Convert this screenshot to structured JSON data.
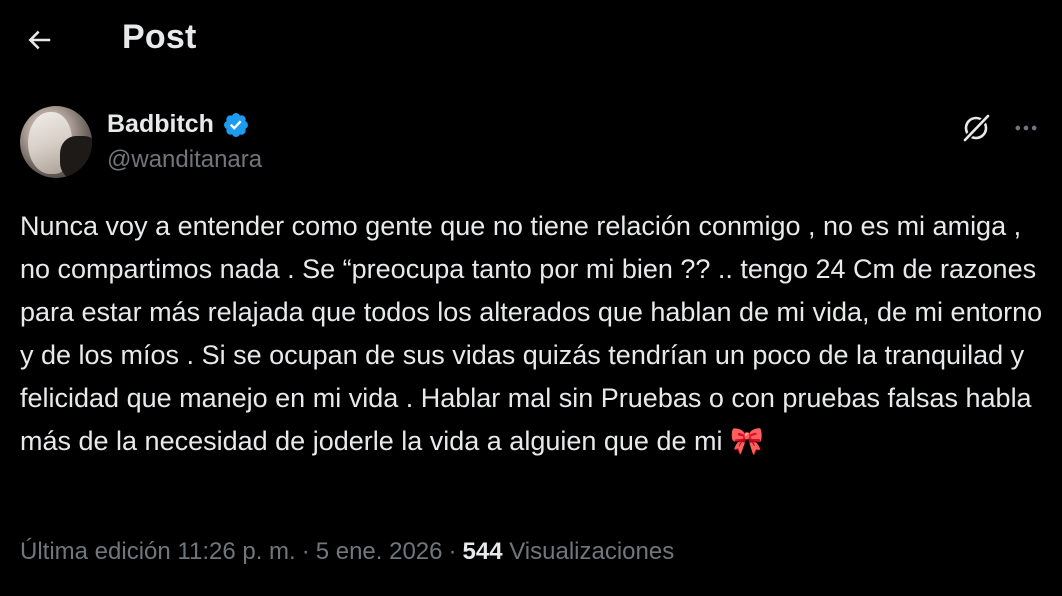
{
  "header": {
    "title": "Post",
    "back_icon": "arrow-left-icon"
  },
  "author": {
    "display_name": "Badbitch",
    "handle": "@wanditanara",
    "verified": true,
    "verified_color": "#1d9bf0"
  },
  "actions": {
    "grok_icon": "grok-icon",
    "more_icon": "more-horizontal-icon"
  },
  "post": {
    "text": "Nunca voy a entender como gente que no tiene relación conmigo , no es mi amiga , no compartimos nada . Se “preocupa tanto por mi bien ?? .. tengo 24 Cm de razones para estar más relajada que todos los alterados que hablan de mi vida, de mi entorno y de los míos . Si se ocupan de sus vidas quizás tendrían un poco de la tranquilad y felicidad que manejo en mi vida . Hablar mal sin Pruebas o con pruebas falsas habla más de la necesidad de joderle la vida a alguien que de mi 🎀"
  },
  "meta": {
    "edited_label": "Última edición",
    "time": "11:26 p. m.",
    "separator": "·",
    "date": "5 ene. 2026",
    "views_count": "544",
    "views_label": "Visualizaciones"
  },
  "colors": {
    "background": "#000000",
    "text_primary": "#e7e9ea",
    "text_secondary": "#71767b",
    "accent": "#1d9bf0"
  }
}
